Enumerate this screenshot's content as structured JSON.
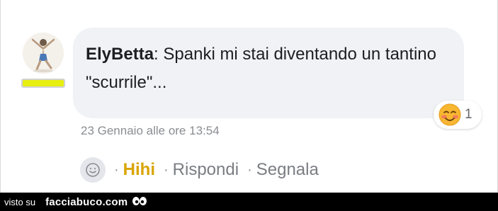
{
  "comment": {
    "author": "ElyBetta",
    "separator": ":",
    "text": " Spanki mi stai diventando un tantino \"scurrile\"...",
    "timestamp": "23 Gennaio alle ore 13:54",
    "reaction": {
      "icon": "blushing-smile-emoji",
      "count": "1"
    },
    "level_badge": {
      "color": "#e6ef10"
    }
  },
  "actions": {
    "emoji_icon": "smiley-outline-icon",
    "hihi": "Hihi",
    "reply": "Rispondi",
    "report": "Segnala",
    "hihi_color": "#d9a400"
  },
  "watermark": {
    "prefix": "visto su",
    "site": "facciabuco.com"
  }
}
